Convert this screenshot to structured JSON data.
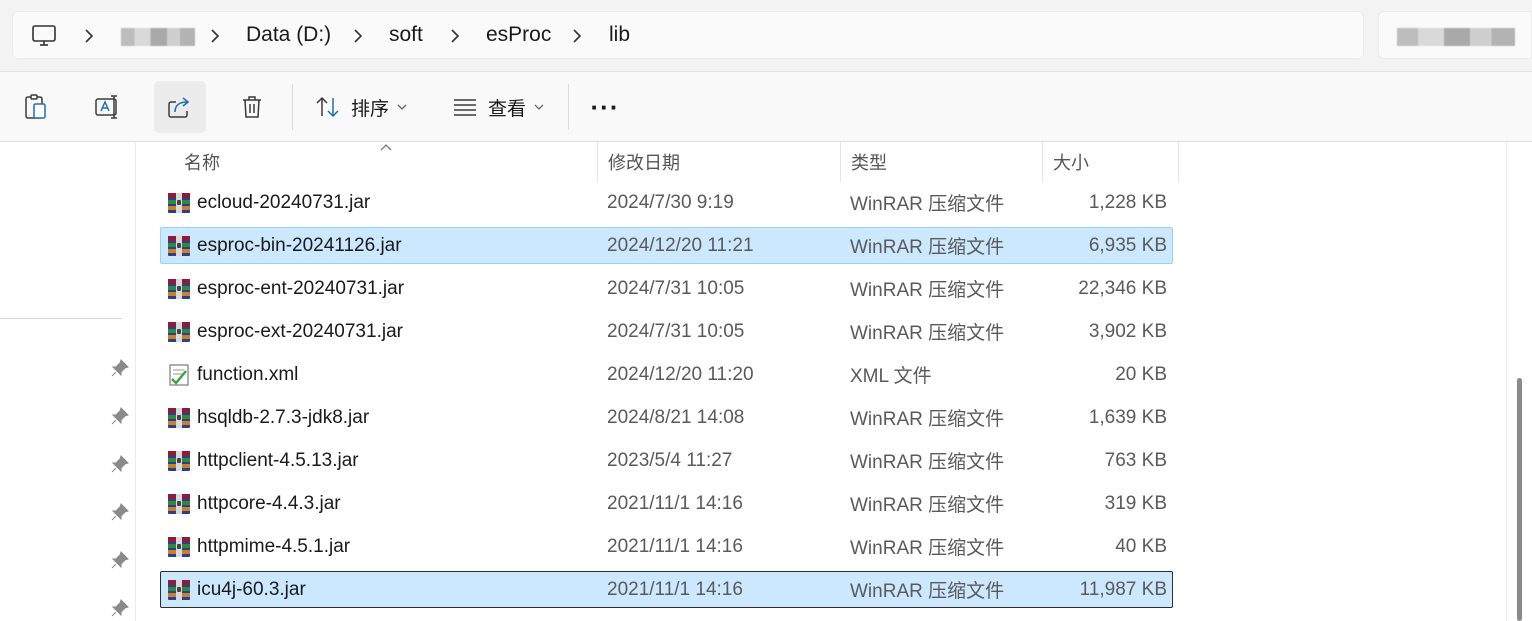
{
  "breadcrumb": {
    "items": [
      "Data (D:)",
      "soft",
      "esProc",
      "lib"
    ]
  },
  "toolbar": {
    "sort_label": "排序",
    "view_label": "查看",
    "more_label": "···"
  },
  "columns": {
    "name": "名称",
    "date": "修改日期",
    "type": "类型",
    "size": "大小"
  },
  "files": [
    {
      "name": "ecloud-20240731.jar",
      "date": "2024/7/30 9:19",
      "type": "WinRAR 压缩文件",
      "size": "1,228 KB",
      "icon": "winrar-archive-icon"
    },
    {
      "name": "esproc-bin-20241126.jar",
      "date": "2024/12/20 11:21",
      "type": "WinRAR 压缩文件",
      "size": "6,935 KB",
      "icon": "winrar-archive-icon"
    },
    {
      "name": "esproc-ent-20240731.jar",
      "date": "2024/7/31 10:05",
      "type": "WinRAR 压缩文件",
      "size": "22,346 KB",
      "icon": "winrar-archive-icon"
    },
    {
      "name": "esproc-ext-20240731.jar",
      "date": "2024/7/31 10:05",
      "type": "WinRAR 压缩文件",
      "size": "3,902 KB",
      "icon": "winrar-archive-icon"
    },
    {
      "name": "function.xml",
      "date": "2024/12/20 11:20",
      "type": "XML 文件",
      "size": "20 KB",
      "icon": "xml-file-icon"
    },
    {
      "name": "hsqldb-2.7.3-jdk8.jar",
      "date": "2024/8/21 14:08",
      "type": "WinRAR 压缩文件",
      "size": "1,639 KB",
      "icon": "winrar-archive-icon"
    },
    {
      "name": "httpclient-4.5.13.jar",
      "date": "2023/5/4 11:27",
      "type": "WinRAR 压缩文件",
      "size": "763 KB",
      "icon": "winrar-archive-icon"
    },
    {
      "name": "httpcore-4.4.3.jar",
      "date": "2021/11/1 14:16",
      "type": "WinRAR 压缩文件",
      "size": "319 KB",
      "icon": "winrar-archive-icon"
    },
    {
      "name": "httpmime-4.5.1.jar",
      "date": "2021/11/1 14:16",
      "type": "WinRAR 压缩文件",
      "size": "40 KB",
      "icon": "winrar-archive-icon"
    },
    {
      "name": "icu4j-60.3.jar",
      "date": "2021/11/1 14:16",
      "type": "WinRAR 压缩文件",
      "size": "11,987 KB",
      "icon": "winrar-archive-icon"
    }
  ],
  "colors": {
    "selection_bg": "#cce8ff",
    "selection_border": "#99d1ff",
    "accent_icon": "#1f6fb5"
  }
}
